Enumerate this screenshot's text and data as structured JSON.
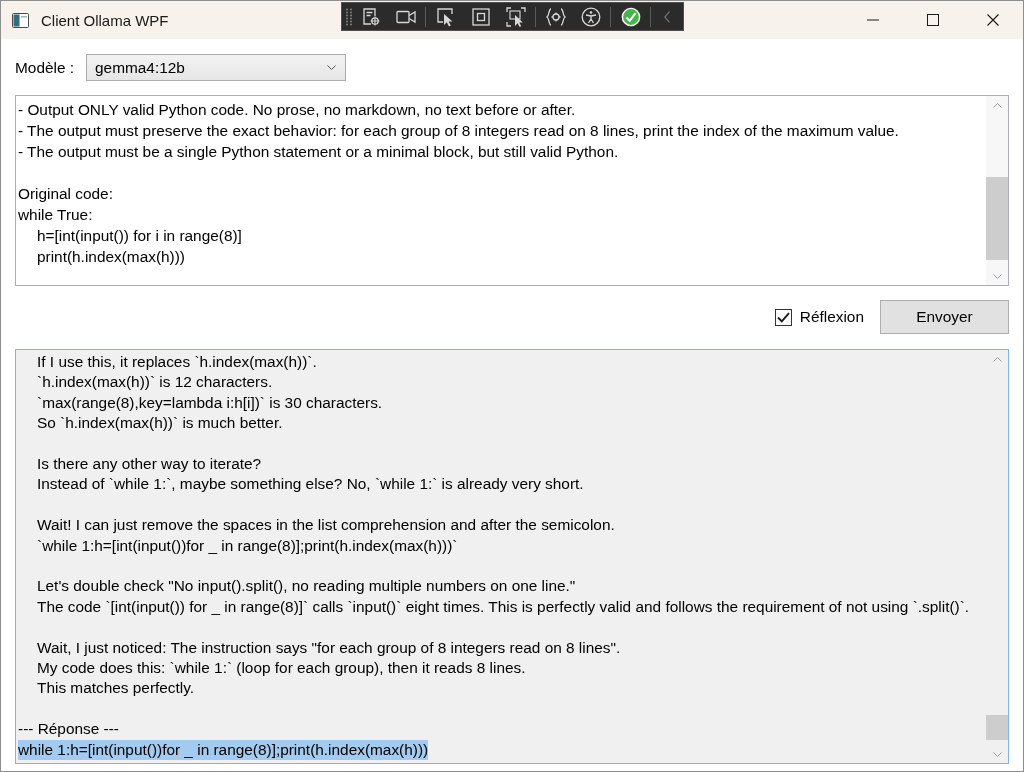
{
  "window": {
    "title": "Client Ollama WPF"
  },
  "model": {
    "label": "Modèle :",
    "value": "gemma4:12b"
  },
  "prompt": {
    "paragraphs": [
      [
        {
          "text": "- Output ONLY valid Python code. No prose, no markdown, no text before or after."
        },
        {
          "text": "- The output must preserve the exact behavior: for each group of 8 integers read on 8 lines, print the index of the maximum value."
        },
        {
          "text": "- The output must be a single Python statement or a minimal block, but still valid Python."
        }
      ],
      [
        {
          "text": "Original code:"
        },
        {
          "text": "while True:",
          "children": [
            {
              "text": "h=[int(input()) for i in range(8)]"
            },
            {
              "text": "print(h.index(max(h)))"
            }
          ]
        }
      ]
    ]
  },
  "reflexion": {
    "label": "Réflexion",
    "checked": true
  },
  "send_button": {
    "label": "Envoyer"
  },
  "output": {
    "thinking": [
      [
        "If I use this, it replaces `h.index(max(h))`.",
        "`h.index(max(h))` is 12 characters.",
        "`max(range(8),key=lambda i:h[i])` is 30 characters.",
        "So `h.index(max(h))` is much better."
      ],
      [
        "Is there any other way to iterate?",
        "Instead of `while 1:`, maybe something else? No, `while 1:` is already very short."
      ],
      [
        "Wait! I can just remove the spaces in the list comprehension and after the semicolon.",
        "`while 1:h=[int(input())for _ in range(8)];print(h.index(max(h)))`"
      ],
      [
        "Let's double check \"No input().split(), no reading multiple numbers on one line.\"",
        "The code `[int(input()) for _ in range(8)]` calls `input()` eight times. This is perfectly valid and follows the requirement of not using `.split()`."
      ],
      [
        "Wait, I just noticed: The instruction says \"for each group of 8 integers read on 8 lines\".",
        "My code does this: `while 1:` (loop for each group), then it reads 8 lines.",
        "This matches perfectly."
      ]
    ],
    "response_header": "--- Réponse ---",
    "response": {
      "text": "while 1:h=[int(input())for _ in range(8)];print(h.index(max(h)))",
      "selected": true
    }
  }
}
